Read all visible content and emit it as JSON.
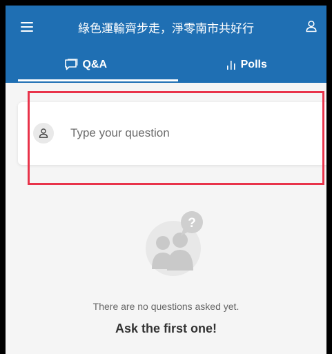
{
  "header": {
    "title": "綠色運輸齊步走，淨零南市共好行",
    "menu_icon": "hamburger-menu-icon",
    "user_icon": "user-icon",
    "background_color": "#1f6fb3"
  },
  "tabs": [
    {
      "label": "Q&A",
      "icon": "chat-bubble-icon",
      "active": true
    },
    {
      "label": "Polls",
      "icon": "bar-chart-icon",
      "active": false
    }
  ],
  "question_box": {
    "placeholder": "Type your question",
    "value": "",
    "avatar_icon": "user-icon"
  },
  "highlight_color": "#e8334a",
  "empty_state": {
    "message": "There are no questions asked yet.",
    "cta": "Ask the first one!",
    "illustration_badge": "?"
  }
}
